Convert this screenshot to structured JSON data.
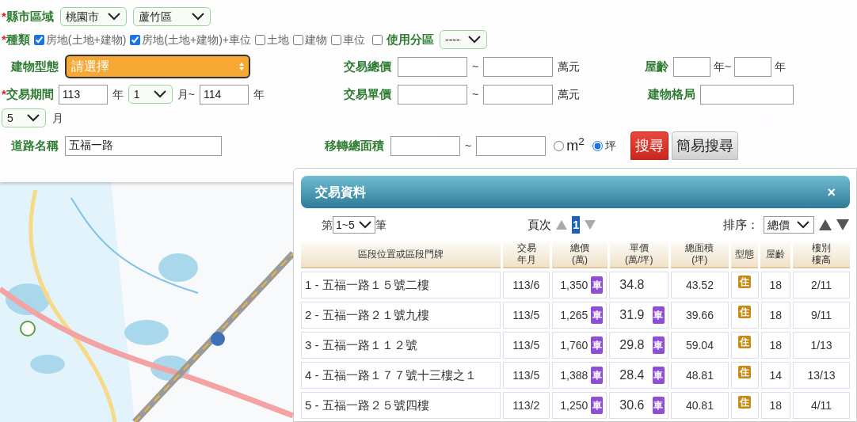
{
  "form": {
    "county": {
      "mark": "*",
      "label": "縣市區域",
      "city": "桃園市",
      "district": "蘆竹區"
    },
    "types": {
      "mark": "*",
      "label": "種類",
      "options": [
        {
          "label": "房地(土地+建物)",
          "checked": true
        },
        {
          "label": "房地(土地+建物)+車位",
          "checked": true
        },
        {
          "label": "土地",
          "checked": false
        },
        {
          "label": "建物",
          "checked": false
        },
        {
          "label": "車位",
          "checked": false
        }
      ]
    },
    "zoning": {
      "label": "使用分區",
      "checked": false,
      "value": "----"
    },
    "building_type": {
      "label": "建物型態",
      "value": "請選擇"
    },
    "total_price": {
      "label": "交易總價",
      "separator": "~",
      "unit": "萬元"
    },
    "age": {
      "label": "屋齡",
      "unit_from": "年~",
      "unit_to": "年"
    },
    "period": {
      "mark": "*",
      "label": "交易期間",
      "from_year": "113",
      "from_year_unit": "年",
      "from_month": "1",
      "from_month_unit": "月~",
      "to_year": "114",
      "to_year_unit": "年",
      "to_month": "5",
      "to_month_unit": "月"
    },
    "unit_price": {
      "label": "交易單價",
      "separator": "~",
      "unit": "萬元"
    },
    "layout": {
      "label": "建物格局"
    },
    "road": {
      "label": "道路名稱",
      "value": "五福一路"
    },
    "area": {
      "label": "移轉總面積",
      "separator": "~",
      "units": [
        {
          "label": "m$^{2}$",
          "selected": false
        },
        {
          "label": "坪",
          "selected": true
        }
      ]
    },
    "buttons": [
      {
        "label": "搜尋",
        "kind": "primary"
      },
      {
        "label": "簡易搜尋",
        "kind": "secondary"
      }
    ]
  },
  "results": {
    "title": "交易資料",
    "close": "×",
    "range_prefix": "第",
    "range": "1~5",
    "range_suffix": "筆",
    "page_label": "頁次",
    "page": "1",
    "sort_label": "排序：",
    "sort": "總價",
    "columns": [
      {
        "lines": [
          "區段位置或區段門牌"
        ]
      },
      {
        "lines": [
          "交易",
          "年月"
        ]
      },
      {
        "lines": [
          "總價",
          "(萬)"
        ]
      },
      {
        "lines": [
          "單價",
          "(萬/坪)"
        ]
      },
      {
        "lines": [
          "總面積",
          "(坪)"
        ]
      },
      {
        "lines": [
          "型態"
        ]
      },
      {
        "lines": [
          "屋齡"
        ]
      },
      {
        "lines": [
          "樓別",
          "樓高"
        ]
      }
    ],
    "rows": [
      {
        "address": "1 - 五福一路１５號二樓",
        "date": "113/6",
        "total": "1,350",
        "total_badge": "車",
        "unit": "34.8",
        "area": "43.52",
        "type": "住",
        "age": "18",
        "floor": "2/11"
      },
      {
        "address": "2 - 五福一路２１號九樓",
        "date": "113/5",
        "total": "1,265",
        "total_badge": "車",
        "unit": "31.9",
        "unit_badge": "車",
        "area": "39.66",
        "type": "住",
        "age": "18",
        "floor": "9/11"
      },
      {
        "address": "3 - 五福一路１１２號",
        "date": "113/5",
        "total": "1,760",
        "total_badge": "車",
        "unit": "29.8",
        "unit_badge": "車",
        "area": "59.04",
        "type": "住",
        "age": "18",
        "floor": "1/13"
      },
      {
        "address": "4 - 五福一路１７７號十三樓之１",
        "date": "113/5",
        "total": "1,388",
        "total_badge": "車",
        "unit": "28.4",
        "unit_badge": "車",
        "area": "48.81",
        "type": "住",
        "age": "14",
        "floor": "13/13"
      },
      {
        "address": "5 - 五福一路２５號四樓",
        "date": "113/2",
        "total": "1,250",
        "total_badge": "車",
        "unit": "30.6",
        "unit_badge": "車",
        "area": "40.81",
        "type": "住",
        "age": "18",
        "floor": "4/11"
      }
    ]
  }
}
